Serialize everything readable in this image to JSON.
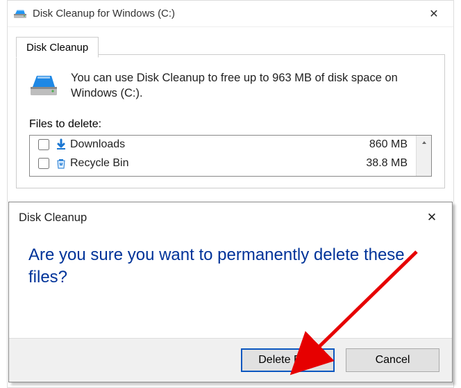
{
  "window": {
    "title": "Disk Cleanup for Windows (C:)"
  },
  "tab": {
    "label": "Disk Cleanup"
  },
  "info": {
    "text": "You can use Disk Cleanup to free up to 963 MB of disk space on Windows (C:)."
  },
  "filesLabel": "Files to delete:",
  "rows": [
    {
      "name": "Downloads",
      "size": "860 MB",
      "checked": false
    },
    {
      "name": "Recycle Bin",
      "size": "38.8 MB",
      "checked": false
    }
  ],
  "dialog": {
    "title": "Disk Cleanup",
    "question": "Are you sure you want to permanently delete these files?",
    "deleteLabel": "Delete Files",
    "cancelLabel": "Cancel"
  }
}
